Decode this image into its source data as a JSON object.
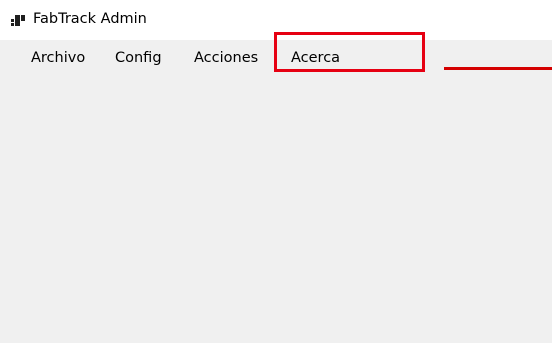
{
  "window": {
    "title": "FabTrack Admin",
    "icon": "app-window-icon",
    "background_color": "#f0f0f0",
    "titlebar_color": "#ffffff"
  },
  "menubar": {
    "items": [
      {
        "label": "Archivo"
      },
      {
        "label": "Config"
      },
      {
        "label": "Acciones"
      },
      {
        "label": "Acerca"
      }
    ]
  },
  "annotation": {
    "highlighted_item": "Acerca",
    "color": "#e60012"
  }
}
